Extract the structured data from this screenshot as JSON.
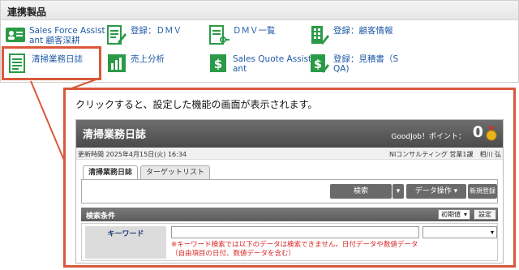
{
  "panel": {
    "title": "連携製品",
    "apps": [
      {
        "line1": "Sales Force Assist",
        "line2": "ant 顧客深耕",
        "icon": "people-card-icon"
      },
      {
        "line1": "登録：ＤＭＶ",
        "line2": "",
        "icon": "form-pencil-icon"
      },
      {
        "line1": "ＤＭＶ一覧",
        "line2": "",
        "icon": "list-key-icon"
      },
      {
        "line1": "登録：顧客情報",
        "line2": "",
        "icon": "building-pencil-icon"
      },
      {
        "line1": "清掃業務日誌",
        "line2": "",
        "icon": "daily-report-icon"
      },
      {
        "line1": "売上分析",
        "line2": "",
        "icon": "bar-chart-icon"
      },
      {
        "line1": "Sales Quote Assist",
        "line2": "ant",
        "icon": "dollar-document-icon"
      },
      {
        "line1": "登録：見積書（S",
        "line2": "QA)",
        "icon": "dollar-pencil-icon"
      }
    ]
  },
  "callout": {
    "text": "クリックすると、設定した機能の画面が表示されます。"
  },
  "screen": {
    "title": "清掃業務日誌",
    "goodjob": "GoodJob！ポイント：",
    "points": "0",
    "updated": "更新時間 2025年4月15日(火) 16:34",
    "user": "NIコンサルティング 営業1課　相川 弘",
    "tabs": [
      "清掃業務日誌",
      "ターゲットリスト"
    ],
    "buttons": {
      "search": "検索",
      "data_ops": "データ操作",
      "new": "新規登録"
    },
    "conditions": {
      "title": "検索条件",
      "initial": "初期値",
      "set": "設定",
      "keyword_label": "キーワード",
      "keyword_value": "",
      "note": "※キーワード検索では以下のデータは検索できません。日付データや数値データ（自由項目の日付、数値データを含む）"
    }
  },
  "colors": {
    "accent": "#d9593c",
    "link": "#1f5aa6",
    "icon_green": "#2b9a47"
  }
}
